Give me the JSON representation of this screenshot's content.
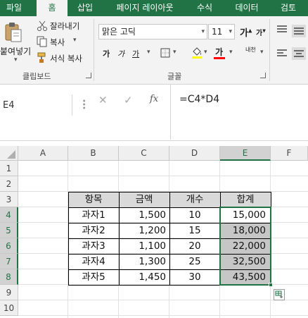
{
  "ribbon_tabs": [
    "파일",
    "홈",
    "삽입",
    "페이지 레이아웃",
    "수식",
    "데이터",
    "검토"
  ],
  "clipboard": {
    "paste_label": "붙여넣기",
    "cut_label": "잘라내기",
    "copy_label": "복사",
    "format_painter_label": "서식 복사",
    "group_label": "클립보드"
  },
  "font": {
    "font_name": "맑은 고딕",
    "font_size": "11",
    "grow_label": "가",
    "shrink_label": "가",
    "bold_label": "가",
    "italic_label": "가",
    "underline_label": "가",
    "font_color_label": "가",
    "phonetic_label": "내천",
    "group_label": "글꼴"
  },
  "formula_bar": {
    "name_box": "E4",
    "cancel_symbol": "✕",
    "enter_symbol": "✓",
    "fx_symbol": "fx",
    "formula": "=C4*D4"
  },
  "grid": {
    "columns": [
      "A",
      "B",
      "C",
      "D",
      "E",
      "F"
    ],
    "rows": [
      "1",
      "2",
      "3",
      "4",
      "5",
      "6",
      "7",
      "8",
      "9",
      "10"
    ],
    "selected_column": "E",
    "selected_rows": [
      "4",
      "5",
      "6",
      "7",
      "8"
    ]
  },
  "table": {
    "headers": [
      "항목",
      "금액",
      "개수",
      "합계"
    ],
    "rows": [
      [
        "과자1",
        "1,500",
        "10",
        "15,000"
      ],
      [
        "과자2",
        "1,200",
        "15",
        "18,000"
      ],
      [
        "과자3",
        "1,100",
        "20",
        "22,000"
      ],
      [
        "과자4",
        "1,300",
        "25",
        "32,500"
      ],
      [
        "과자5",
        "1,450",
        "30",
        "43,500"
      ]
    ]
  },
  "colors": {
    "excel_green": "#217346",
    "header_fill": "#d9d9d9",
    "selection_fill": "#c6c6c6",
    "font_color_bar": "#ff0000"
  }
}
